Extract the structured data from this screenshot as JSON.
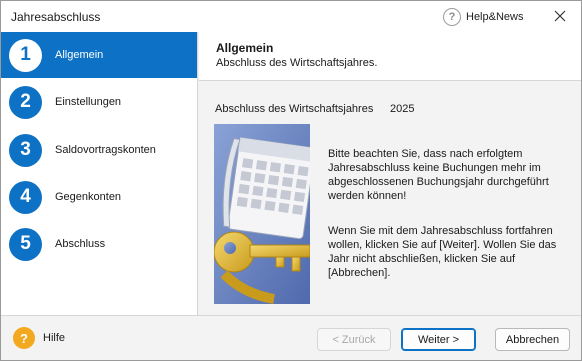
{
  "window": {
    "title": "Jahresabschluss"
  },
  "helpnews": {
    "label": "Help&News",
    "icon": "question-circle-icon"
  },
  "close_icon": "close-icon",
  "steps": [
    {
      "number": "1",
      "label": "Allgemein",
      "active": true
    },
    {
      "number": "2",
      "label": "Einstellungen",
      "active": false
    },
    {
      "number": "3",
      "label": "Saldovortragskonten",
      "active": false
    },
    {
      "number": "4",
      "label": "Gegenkonten",
      "active": false
    },
    {
      "number": "5",
      "label": "Abschluss",
      "active": false
    }
  ],
  "header": {
    "title": "Allgemein",
    "subtitle": "Abschluss des Wirtschaftsjahres."
  },
  "main": {
    "year_label": "Abschluss des Wirtschaftsjahres",
    "year_value": "2025",
    "illustration_icon": "calendar-key-illustration",
    "paragraph1": "Bitte beachten Sie, dass nach erfolgtem Jahresabschluss keine Buchungen mehr im abgeschlossenen Buchungsjahr durchgeführt werden können!",
    "paragraph2": "Wenn Sie mit dem Jahresabschluss fortfahren wollen, klicken Sie auf [Weiter]. Wollen Sie das Jahr nicht abschließen, klicken Sie auf [Abbrechen]."
  },
  "footer": {
    "help_label": "Hilfe",
    "back_label": "< Zurück",
    "next_label": "Weiter >",
    "cancel_label": "Abbrechen"
  },
  "colors": {
    "accent": "#0d72c5",
    "help": "#f2a81f",
    "illustration_bg": "#6b86c4",
    "key": "#e9c13c"
  }
}
